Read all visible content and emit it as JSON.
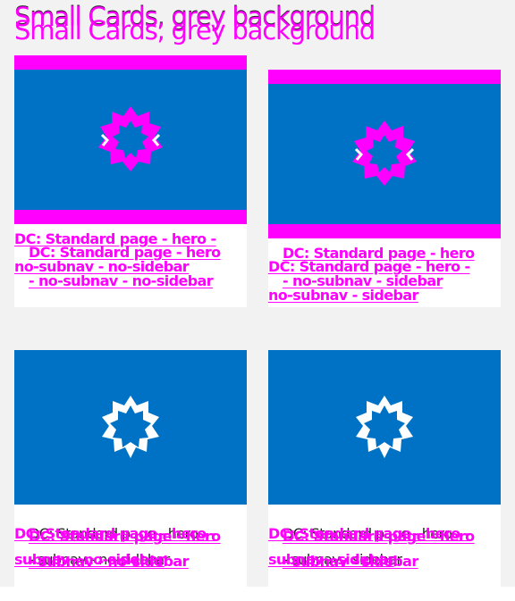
{
  "heading": {
    "text": "Small Cards, grey background"
  },
  "colors": {
    "accent": "#ff00ff",
    "media_blue": "#0072c6",
    "page_bg": "#f2f2f2",
    "card_bg": "#ffffff",
    "text_dark": "#222222"
  },
  "icons": {
    "card_media": "star-burst-icon"
  },
  "cards": [
    {
      "title_line1": "DC: Standard page - hero -",
      "title_line2": "no-subnav - no-sidebar",
      "overlay_line1": "DC: Standard page - hero",
      "overlay_line2": "- no-subnav - no-sidebar"
    },
    {
      "title_line1": "DC: Standard page - hero -",
      "title_line2": "no-subnav - sidebar",
      "overlay_line1": "DC: Standard page - hero",
      "overlay_line2": "- no-subnav - sidebar"
    },
    {
      "title_line1": "DC: Standard page - hero -",
      "title_line2": "subnav - no-sidebar",
      "overlay_line1": "DC: Standard page - hero",
      "overlay_line2": "- subnav - no-sidebar"
    },
    {
      "title_line1": "DC: Standard page - hero -",
      "title_line2": "subnav - sidebar",
      "overlay_line1": "DC: Standard page - hero",
      "overlay_line2": "- subnav - sidebar"
    }
  ]
}
